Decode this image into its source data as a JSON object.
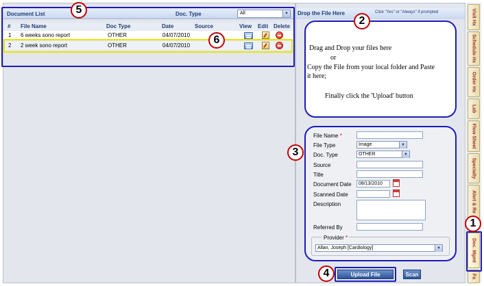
{
  "colors": {
    "annotation": "#1d1ab8",
    "highlight": "#e6e600",
    "badge_border": "#c00000",
    "header_text": "#1f3b75"
  },
  "document_list": {
    "title": "Document List",
    "doc_type_label": "Doc. Type",
    "doc_type_value": "All",
    "columns": [
      "#",
      "File Name",
      "Doc Type",
      "Date",
      "Source",
      "View",
      "Edit",
      "Delete"
    ],
    "rows": [
      {
        "num": "1",
        "file_name": "6 weeks sono report",
        "doc_type": "OTHER",
        "date": "04/07/2010",
        "source": ""
      },
      {
        "num": "2",
        "file_name": "2 week sono report",
        "doc_type": "OTHER",
        "date": "04/07/2010",
        "source": ""
      }
    ]
  },
  "drop": {
    "title": "Drop the File Here",
    "hint": "Click \"Yes\" or \"Always\" if prompted",
    "line1": "Drag and Drop your files here",
    "line2": "or",
    "line3": "Copy the File from your local folder and Paste",
    "line4": "it here;",
    "line5": "Finally click the 'Upload' button"
  },
  "form": {
    "file_name_label": "File Name",
    "file_name_value": "",
    "file_type_label": "File Type",
    "file_type_value": "Image",
    "doc_type_label": "Doc. Type",
    "doc_type_value": "OTHER",
    "source_label": "Source",
    "title_label": "Title",
    "document_date_label": "Document Date",
    "document_date_value": "08/13/2010",
    "scanned_date_label": "Scanned Date",
    "scanned_date_value": "",
    "description_label": "Description",
    "referred_by_label": "Referred By",
    "provider_label": "Provider",
    "provider_value": "Allan, Joseph [Cardiology]",
    "required_mark": "*"
  },
  "buttons": {
    "upload": "Upload File",
    "scan": "Scan"
  },
  "tabs": [
    "Visit Hx",
    "Schedule Hx",
    "Order Hx",
    "Lab",
    "Flow Sheet",
    "Specialty",
    "Alert & Re",
    "Doc. Mgmt",
    "Fa"
  ],
  "annotations": [
    "1",
    "2",
    "3",
    "4",
    "5",
    "6"
  ]
}
